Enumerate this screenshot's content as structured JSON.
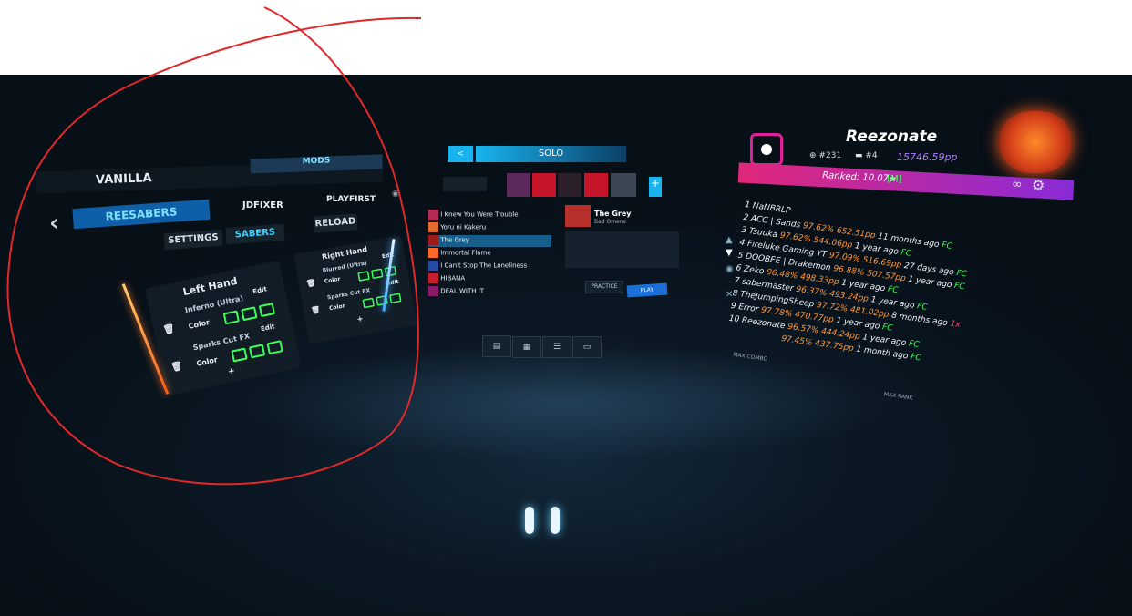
{
  "mods": {
    "tabs": [
      "VANILLA",
      "MODS"
    ],
    "mod_tabs": [
      "REESABERS",
      "JDFIXER",
      "PLAYFIRST"
    ],
    "sub_tabs": [
      "SETTINGS",
      "SABERS"
    ],
    "reload": "RELOAD",
    "left_hand": {
      "title": "Left Hand",
      "slots": [
        {
          "name": "Inferno (Ultra)",
          "edit": "Edit",
          "color": "Color"
        },
        {
          "name": "Sparks Cut FX",
          "edit": "Edit",
          "color": "Color"
        }
      ],
      "add": "+"
    },
    "right_hand": {
      "title": "Right Hand",
      "slots": [
        {
          "name": "Blurred (Ultra)",
          "edit": "Edit",
          "color": "Color"
        },
        {
          "name": "Sparks Cut FX",
          "edit": "Edit",
          "color": "Color"
        }
      ],
      "add": "+"
    }
  },
  "center": {
    "title": "SOLO",
    "back": "<",
    "songs": [
      "I Knew You Were Trouble",
      "Yoru ni Kakeru",
      "The Grey",
      "Immortal Flame",
      "I Can't Stop The Loneliness",
      "HIBANA",
      "DEAL WITH IT"
    ],
    "selected": {
      "title": "The Grey",
      "artist": "Bad Omens"
    },
    "practice": "PRACTICE",
    "play": "PLAY"
  },
  "profile": {
    "name": "Reezonate",
    "global_rank": "#231",
    "country_rank": "#4",
    "pp": "15746.59pp",
    "ranked": "Ranked: 10.07★",
    "ranked_diff": "[M]"
  },
  "leaderboard": [
    {
      "rank": "1",
      "name": "NaNBRLP",
      "acc": "",
      "pp": "",
      "time": "",
      "fc": ""
    },
    {
      "rank": "2",
      "name": "ACC | Sands",
      "acc": "97.62%",
      "pp": "652.51pp",
      "time": "11 months ago",
      "fc": "FC"
    },
    {
      "rank": "3",
      "name": "Tsuuka",
      "acc": "97.62%",
      "pp": "544.06pp",
      "time": "1 year ago",
      "fc": "FC"
    },
    {
      "rank": "4",
      "name": "Fireluke Gaming YT",
      "acc": "97.09%",
      "pp": "516.69pp",
      "time": "27 days ago",
      "fc": "FC"
    },
    {
      "rank": "5",
      "name": "DOOBEE | Drakemon",
      "acc": "96.88%",
      "pp": "507.57pp",
      "time": "1 year ago",
      "fc": "FC"
    },
    {
      "rank": "6",
      "name": "Zeko",
      "acc": "96.48%",
      "pp": "498.33pp",
      "time": "1 year ago",
      "fc": "FC"
    },
    {
      "rank": "7",
      "name": "sabermaster",
      "acc": "96.37%",
      "pp": "493.24pp",
      "time": "1 year ago",
      "fc": "FC"
    },
    {
      "rank": "8",
      "name": "TheJumpingSheep",
      "acc": "97.72%",
      "pp": "481.02pp",
      "time": "8 months ago",
      "fc": "1x"
    },
    {
      "rank": "9",
      "name": "Error",
      "acc": "97.78%",
      "pp": "470.77pp",
      "time": "1 year ago",
      "fc": "FC"
    },
    {
      "rank": "10",
      "name": "Reezonate",
      "acc": "96.57%",
      "pp": "444.24pp",
      "time": "1 year ago",
      "fc": "FC"
    },
    {
      "rank": "",
      "name": "",
      "acc": "97.45%",
      "pp": "437.75pp",
      "time": "1 month ago",
      "fc": "FC"
    }
  ],
  "leader_footer": {
    "left": "MAX COMBO",
    "right": "MAX RANK"
  },
  "bottom_buttons": [
    "bars",
    "grid",
    "list",
    "window"
  ],
  "colors": {
    "accent": "#18b4f0",
    "ranked": "#b25cff",
    "fc": "#3cff5a",
    "acc": "#ff9b3d",
    "annotation": "#e0282a"
  }
}
